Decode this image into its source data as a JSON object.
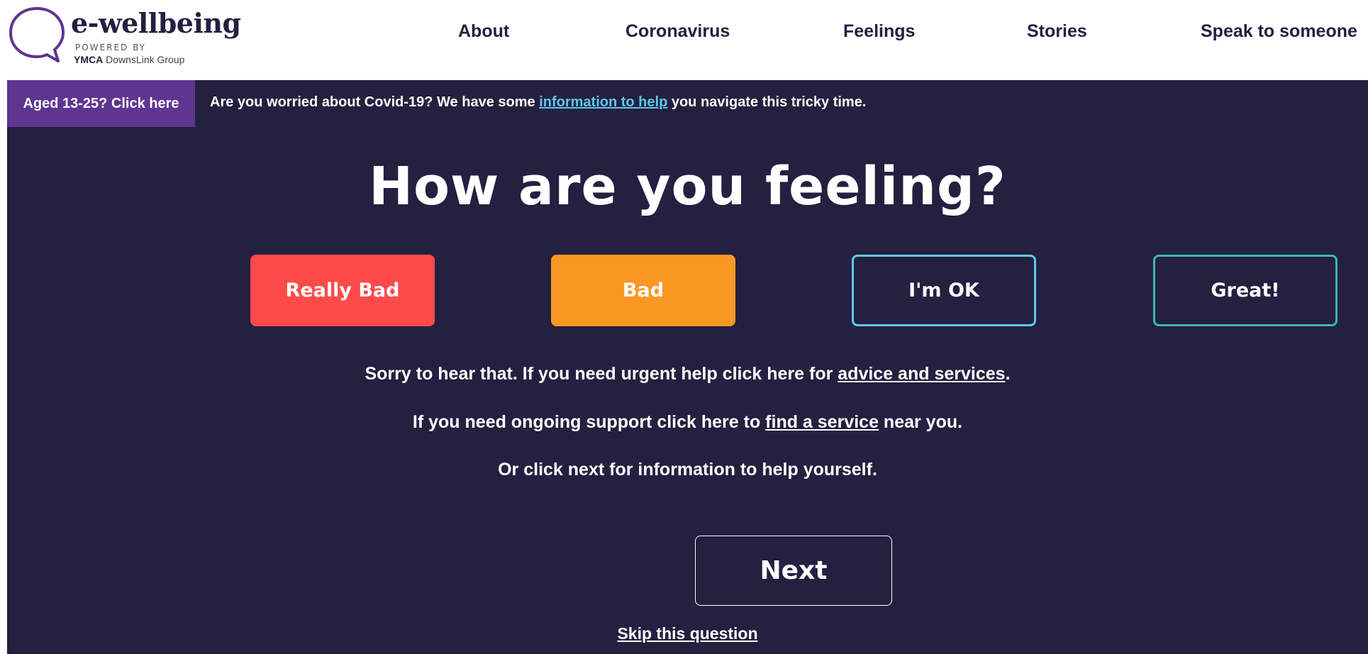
{
  "header": {
    "logo": {
      "name": "e-wellbeing",
      "powered_by": "POWERED BY",
      "group_ymca": "YMCA",
      "group_rest": " DownsLink Group"
    },
    "nav": [
      {
        "label": "About",
        "icon": ""
      },
      {
        "label": "Coronavirus"
      },
      {
        "label": "Feelings"
      },
      {
        "label": "Stories"
      },
      {
        "label": "Speak to someone"
      }
    ]
  },
  "banner": {
    "aged_tab": "Aged 13-25? Click here",
    "text_before": "Are you worried about Covid-19? We have some ",
    "link": "information to help",
    "text_after": " you navigate this tricky time."
  },
  "main": {
    "heading": "How are you feeling?",
    "moods": [
      {
        "label": "Really Bad",
        "color": "#ff4a4a"
      },
      {
        "label": "Bad",
        "color": "#f99823"
      },
      {
        "label": "I'm OK",
        "color": "#5ec8ea"
      },
      {
        "label": "Great!",
        "color": "#3fb8a8"
      }
    ],
    "message1": {
      "before": "Sorry to hear that. If you need urgent help click here for ",
      "link": "advice and services",
      "after": "."
    },
    "message2": {
      "before": "If you need ongoing support click here to ",
      "link": "find a service",
      "after": " near you."
    },
    "message3": "Or click next for information to help yourself.",
    "next_label": "Next",
    "skip_label": "Skip this question"
  },
  "colors": {
    "background": "#232040",
    "brand_purple": "#5e3590",
    "link_blue": "#5ec8ea"
  }
}
